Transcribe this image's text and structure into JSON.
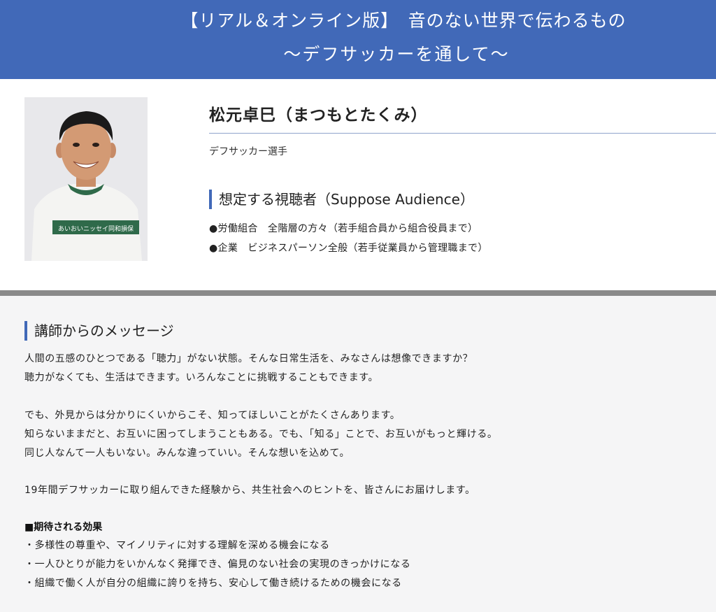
{
  "header": {
    "line1": "【リアル＆オンライン版】　音のない世界で伝わるもの",
    "line2": "～デフサッカーを通して～"
  },
  "profile": {
    "name": "松元卓巳（まつもとたくみ）",
    "role": "デフサッカー選手",
    "shirt_text": "あいおいニッセイ同和損保"
  },
  "audience": {
    "title": "想定する視聴者（Suppose Audience）",
    "items": [
      "●労働組合　全階層の方々（若手組合員から組合役員まで）",
      "●企業　ビジネスパーソン全般（若手従業員から管理職まで）"
    ]
  },
  "message": {
    "title": "講師からのメッセージ",
    "lines": [
      "人間の五感のひとつである「聴力」がない状態。そんな日常生活を、みなさんは想像できますか？",
      "聴力がなくても、生活はできます。いろんなことに挑戦することもできます。",
      "でも、外見からは分かりにくいからこそ、知ってほしいことがたくさんあります。",
      "知らないままだと、お互いに困ってしまうこともある。でも、「知る」ことで、お互いがもっと輝ける。",
      "同じ人なんて一人もいない。みんな違っていい。そんな想いを込めて。",
      "19年間デフサッカーに取り組んできた経験から、共生社会へのヒントを、皆さんにお届けします。"
    ],
    "effects_title": "■期待される効果",
    "effects": [
      "・多様性の尊重や、マイノリティに対する理解を深める機会になる",
      "・一人ひとりが能力をいかんなく発揮でき、偏見のない社会の実現のきっかけになる",
      "・組織で働く人が自分の組織に誇りを持ち、安心して働き続けるための機会になる"
    ]
  },
  "colors": {
    "header_bg": "#4169b8",
    "accent": "#4169b8",
    "divider": "#8a8a8a",
    "message_bg": "#f5f5f6"
  }
}
